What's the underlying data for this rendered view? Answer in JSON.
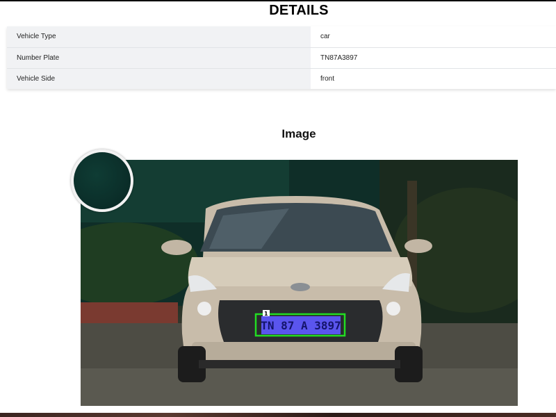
{
  "details": {
    "title": "DETAILS",
    "rows": [
      {
        "label": "Vehicle Type",
        "value": "car"
      },
      {
        "label": "Number Plate",
        "value": "TN87A3897"
      },
      {
        "label": "Vehicle Side",
        "value": "front"
      }
    ]
  },
  "image_section": {
    "heading": "Image",
    "plate_text": "TN 87 A 3897",
    "detection_label": "1",
    "detection_box_color": "#22dd22",
    "plate_overlay_color": "#5a55ee"
  }
}
